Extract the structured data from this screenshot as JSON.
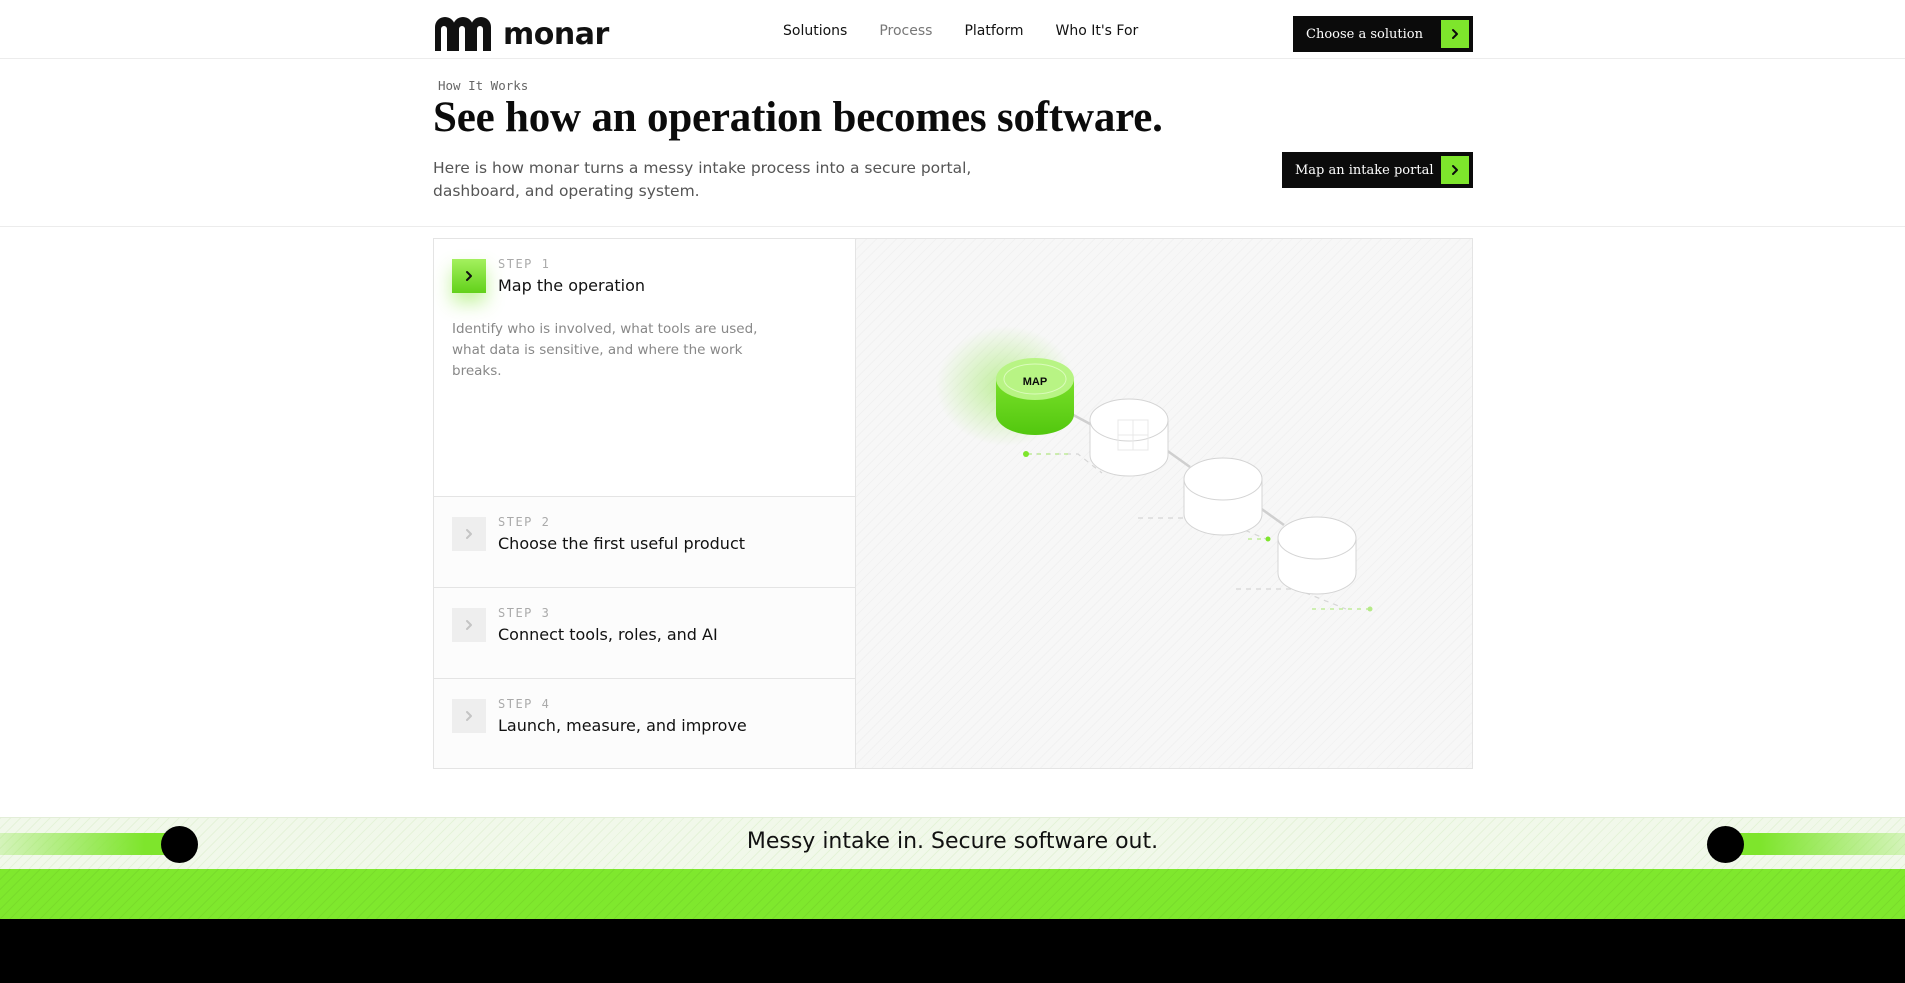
{
  "brand": {
    "name": "monar",
    "accent": "#7ee52c",
    "dark": "#0b0b0b"
  },
  "nav": {
    "links": [
      {
        "label": "Solutions"
      },
      {
        "label": "Process"
      },
      {
        "label": "Platform"
      },
      {
        "label": "Who It's For"
      }
    ],
    "cta_label": "Choose a solution"
  },
  "hero": {
    "eyebrow": "How It Works",
    "title": "See how an operation becomes software.",
    "description": "Here is how monar turns a messy intake process into a secure portal, dashboard, and operating system.",
    "cta_label": "Map an intake portal"
  },
  "steps": [
    {
      "kicker": "STEP 1",
      "title": "Map the operation",
      "body": "Identify who is involved, what tools are used, what data is sensitive, and where the work breaks.",
      "active": true
    },
    {
      "kicker": "STEP 2",
      "title": "Choose the first useful product",
      "active": false
    },
    {
      "kicker": "STEP 3",
      "title": "Connect tools, roles, and AI",
      "active": false
    },
    {
      "kicker": "STEP 4",
      "title": "Launch, measure, and improve",
      "active": false
    }
  ],
  "viz": {
    "active_node_label": "MAP"
  },
  "banner": {
    "text": "Messy intake in. Secure software out."
  }
}
